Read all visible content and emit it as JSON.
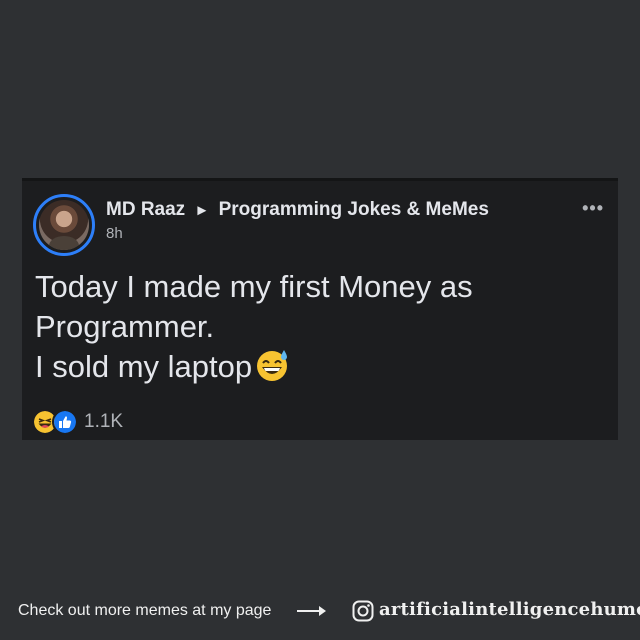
{
  "post": {
    "author": "MD Raaz",
    "arrow": "►",
    "group": "Programming Jokes & MeMes",
    "time": "8h",
    "more_icon": "more-options-icon",
    "text_lines": [
      "Today I made my first Money as",
      "Programmer.",
      "I sold my laptop"
    ],
    "inline_emoji": "grinning-sweat-emoji",
    "reactions": {
      "icons": [
        "laugh-reaction-icon",
        "like-reaction-icon"
      ],
      "count": "1.1K"
    }
  },
  "footer": {
    "cta": "Check out more memes at my page",
    "handle": "artificialintelligencehumor",
    "icons": [
      "arrow-right-icon",
      "instagram-icon"
    ]
  },
  "colors": {
    "background": "#2e3033",
    "card": "#1c1d1f",
    "text_primary": "#e4e6eb",
    "text_secondary": "#b0b3b8",
    "avatar_ring": "#2d7ff9",
    "like_blue": "#1877f2",
    "emoji_yellow": "#f7c331"
  }
}
